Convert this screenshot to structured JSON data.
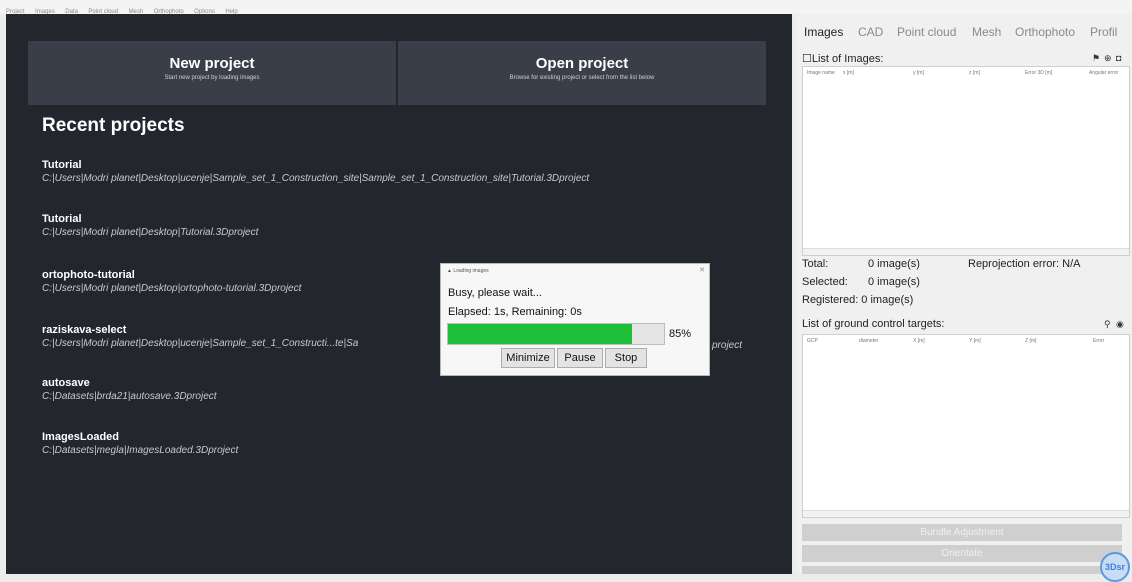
{
  "menu": [
    "Project",
    "Images",
    "Data",
    "Point cloud",
    "Mesh",
    "Orthophoto",
    "Options",
    "Help"
  ],
  "start": {
    "new_title": "New project",
    "new_sub": "Start new project by loading images",
    "open_title": "Open project",
    "open_sub": "Browse for existing project or select from the list below",
    "recent_title": "Recent projects"
  },
  "projects": [
    {
      "name": "Tutorial",
      "path": "C:|Users|Modri planet|Desktop|ucenje|Sample_set_1_Construction_site|Sample_set_1_Construction_site|Tutorial.3Dproject"
    },
    {
      "name": "Tutorial",
      "path": "C:|Users|Modri planet|Desktop|Tutorial.3Dproject"
    },
    {
      "name": "ortophoto-tutorial",
      "path": "C:|Users|Modri planet|Desktop|ortophoto-tutorial.3Dproject"
    },
    {
      "name": "raziskava-select",
      "path": "C:|Users|Modri planet|Desktop|ucenje|Sample_set_1_Constructi...te|Sa",
      "path_tail": "project"
    },
    {
      "name": "autosave",
      "path": "C:|Datasets|brda21|autosave.3Dproject"
    },
    {
      "name": "ImagesLoaded",
      "path": "C:|Datasets|megla|ImagesLoaded.3Dproject"
    }
  ],
  "dialog": {
    "title": "Loading images",
    "busy": "Busy, please wait...",
    "elapsed": "Elapsed: 1s, Remaining: 0s",
    "progress": 0.85,
    "percent": "85%",
    "minimize": "Minimize",
    "pause": "Pause",
    "stop": "Stop"
  },
  "tabs": [
    "Images",
    "CAD",
    "Point cloud",
    "Mesh",
    "Orthophoto",
    "Profil"
  ],
  "images_panel": {
    "list_label": "List of Images:",
    "columns": [
      "Image name",
      "x [m]",
      "y [m]",
      "z [m]",
      "Error 3D [m]",
      "Angular error"
    ],
    "total_label": "Total:",
    "total_value": "0 image(s)",
    "reproj": "Reprojection error: N/A",
    "selected_label": "Selected:",
    "selected_value": "0 image(s)",
    "registered": "Registered: 0 image(s)"
  },
  "gcp_panel": {
    "label": "List of ground control targets:",
    "columns": [
      "GCP",
      "diameter",
      "X [m]",
      "Y [m]",
      "Z [m]",
      "Error"
    ]
  },
  "buttons": {
    "bundle": "Bundle Adjustment",
    "orientate": "Orientate"
  },
  "logo": "3Dsr"
}
